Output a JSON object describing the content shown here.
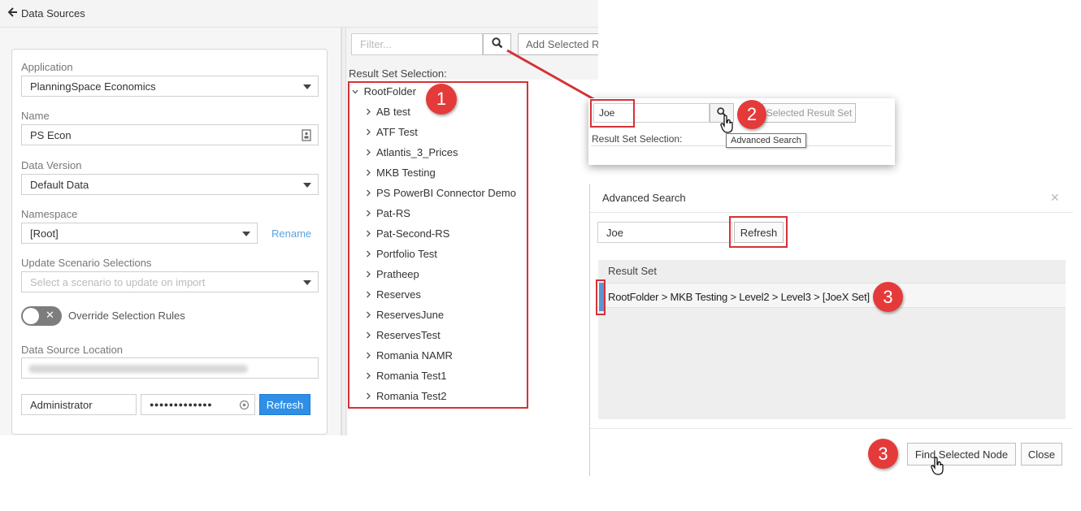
{
  "header": {
    "back_icon": "arrow-left-icon",
    "back_label": "Data Sources"
  },
  "form": {
    "application_label": "Application",
    "application_value": "PlanningSpace Economics",
    "name_label": "Name",
    "name_value": "PS Econ",
    "data_version_label": "Data Version",
    "data_version_value": "Default Data",
    "namespace_label": "Namespace",
    "namespace_value": "[Root]",
    "rename_link": "Rename",
    "update_label": "Update Scenario Selections",
    "update_placeholder": "Select a scenario to update on import",
    "override_label": "Override Selection Rules",
    "location_label": "Data Source Location",
    "username_value": "Administrator",
    "password_mask": "●●●●●●●●●●●●●",
    "refresh_label": "Refresh"
  },
  "result_panel": {
    "filter_placeholder": "Filter...",
    "add_selected_label": "Add Selected R",
    "selection_label": "Result Set Selection:",
    "root_label": "RootFolder",
    "items": [
      "AB test",
      "ATF Test",
      "Atlantis_3_Prices",
      "MKB Testing",
      "PS PowerBI Connector Demo",
      "Pat-RS",
      "Pat-Second-RS",
      "Portfolio Test",
      "Pratheep",
      "Reserves",
      "ReservesJune",
      "ReservesTest",
      "Romania NAMR",
      "Romania Test1",
      "Romania Test2"
    ]
  },
  "zoom_popup": {
    "search_value": "Joe",
    "add_selected_label": "Selected Result Set",
    "selection_label": "Result Set Selection:",
    "tooltip": "Advanced Search"
  },
  "advanced_search": {
    "title": "Advanced Search",
    "search_value": "Joe",
    "refresh_label": "Refresh",
    "column_header": "Result Set",
    "result_path": "RootFolder > MKB Testing > Level2 > Level3 > [JoeX Set]",
    "find_button": "Find Selected Node",
    "close_button": "Close"
  },
  "badges": {
    "one": "1",
    "two": "2",
    "three_a": "3",
    "three_b": "3"
  },
  "colors": {
    "accent_blue": "#2f8fe6",
    "annotation_red": "#d43237",
    "badge_red": "#e53a3a"
  }
}
